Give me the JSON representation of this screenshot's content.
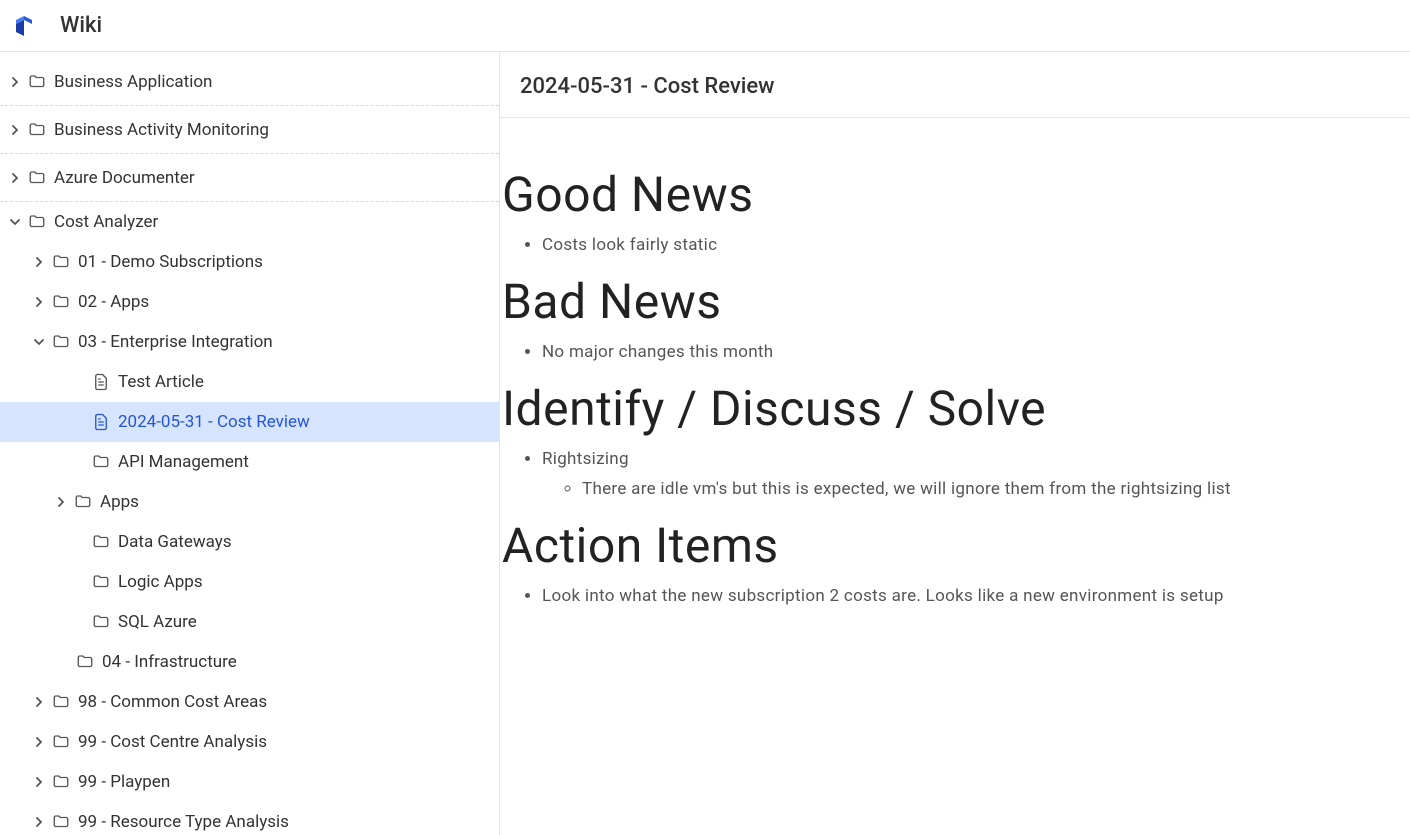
{
  "header": {
    "app_title": "Wiki"
  },
  "sidebar": {
    "items": [
      {
        "label": "Business Application",
        "level": 0,
        "chevron": "right",
        "icon": "folder",
        "selected": false,
        "dashed": true
      },
      {
        "label": "Business Activity Monitoring",
        "level": 0,
        "chevron": "right",
        "icon": "folder",
        "selected": false,
        "dashed": true
      },
      {
        "label": "Azure Documenter",
        "level": 0,
        "chevron": "right",
        "icon": "folder",
        "selected": false,
        "dashed": true
      },
      {
        "label": "Cost Analyzer",
        "level": 0,
        "chevron": "down",
        "icon": "folder",
        "selected": false,
        "dashed": false
      },
      {
        "label": "01 - Demo Subscriptions",
        "level": 1,
        "chevron": "right",
        "icon": "folder",
        "selected": false,
        "dashed": false
      },
      {
        "label": "02 - Apps",
        "level": 1,
        "chevron": "right",
        "icon": "folder",
        "selected": false,
        "dashed": false
      },
      {
        "label": "03 - Enterprise Integration",
        "level": 1,
        "chevron": "down",
        "icon": "folder",
        "selected": false,
        "dashed": false
      },
      {
        "label": "Test Article",
        "level": 3,
        "chevron": "none",
        "icon": "file",
        "selected": false,
        "dashed": false
      },
      {
        "label": "2024-05-31 - Cost Review",
        "level": 3,
        "chevron": "none",
        "icon": "file",
        "selected": true,
        "dashed": false
      },
      {
        "label": "API Management",
        "level": 3,
        "chevron": "none",
        "icon": "folder",
        "selected": false,
        "dashed": false
      },
      {
        "label": "Apps",
        "level": 3,
        "chevron": "right",
        "icon": "folder",
        "selected": false,
        "dashed": false,
        "chevOffset": true
      },
      {
        "label": "Data Gateways",
        "level": 3,
        "chevron": "none",
        "icon": "folder",
        "selected": false,
        "dashed": false
      },
      {
        "label": "Logic Apps",
        "level": 3,
        "chevron": "none",
        "icon": "folder",
        "selected": false,
        "dashed": false
      },
      {
        "label": "SQL Azure",
        "level": 3,
        "chevron": "none",
        "icon": "folder",
        "selected": false,
        "dashed": false
      },
      {
        "label": "04 - Infrastructure",
        "level": 2,
        "chevron": "none",
        "icon": "folder",
        "selected": false,
        "dashed": false
      },
      {
        "label": "98 - Common Cost Areas",
        "level": 1,
        "chevron": "right",
        "icon": "folder",
        "selected": false,
        "dashed": false
      },
      {
        "label": "99 - Cost Centre Analysis",
        "level": 1,
        "chevron": "right",
        "icon": "folder",
        "selected": false,
        "dashed": false
      },
      {
        "label": "99 - Playpen",
        "level": 1,
        "chevron": "right",
        "icon": "folder",
        "selected": false,
        "dashed": false
      },
      {
        "label": "99 - Resource Type Analysis",
        "level": 1,
        "chevron": "right",
        "icon": "folder",
        "selected": false,
        "dashed": false
      }
    ]
  },
  "content": {
    "page_title": "2024-05-31 - Cost Review",
    "sections": [
      {
        "heading": "Good News",
        "bullets": [
          {
            "text": "Costs look fairly static",
            "children": []
          }
        ]
      },
      {
        "heading": "Bad News",
        "bullets": [
          {
            "text": "No major changes this month",
            "children": []
          }
        ]
      },
      {
        "heading": "Identify / Discuss / Solve",
        "bullets": [
          {
            "text": "Rightsizing",
            "children": [
              "There are idle vm's but this is expected, we will ignore them from the rightsizing list"
            ]
          }
        ]
      },
      {
        "heading": "Action Items",
        "bullets": [
          {
            "text": "Look into what the new subscription 2 costs are. Looks like a new environment is setup",
            "children": []
          }
        ]
      }
    ]
  }
}
